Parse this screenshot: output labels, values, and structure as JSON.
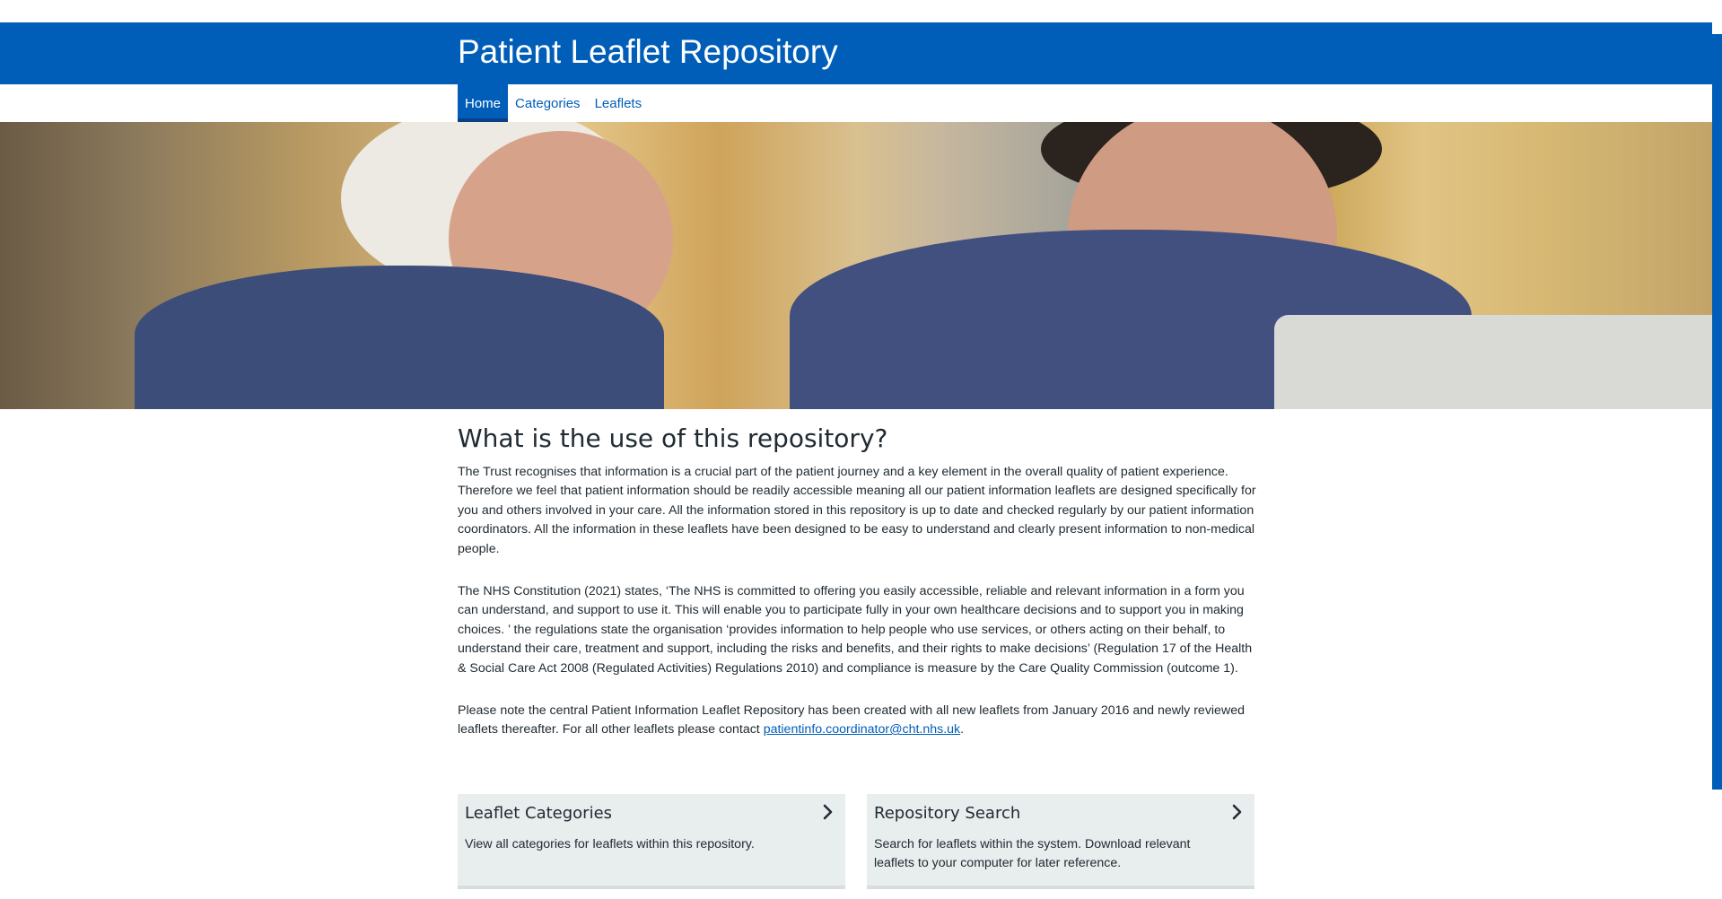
{
  "header": {
    "title": "Patient Leaflet Repository"
  },
  "nav": {
    "items": [
      {
        "label": "Home",
        "active": true
      },
      {
        "label": "Categories",
        "active": false
      },
      {
        "label": "Leaflets",
        "active": false
      }
    ]
  },
  "main": {
    "heading": "What is the use of this repository?",
    "paragraph_1": "The Trust recognises that information is a crucial part of the patient journey and a key element in the overall quality of patient experience. Therefore we feel that patient information should be readily accessible meaning all our patient information leaflets are designed specifically for you and others involved in your care. All the information stored in this repository is up to date and checked regularly by our patient information coordinators. All the information in these leaflets have been designed to be easy to understand and clearly present information to non-medical people.",
    "paragraph_2": "The NHS Constitution (2021) states, ‘The NHS is committed to offering you easily accessible, reliable and relevant information in a form you can understand, and support to use it. This will enable you to participate fully in your own healthcare decisions and to support you in making choices. ’ the regulations state the organisation ‘provides information to help people who use services, or others acting on their behalf, to understand their care, treatment and support, including the risks and benefits, and their rights to make decisions’ (Regulation 17 of the Health & Social Care Act 2008 (Regulated Activities) Regulations 2010) and compliance is measure by the Care Quality Commission (outcome 1).",
    "paragraph_3_prefix": "Please note the central Patient Information Leaflet Repository has been created with all new leaflets from January 2016 and newly reviewed leaflets thereafter. For all other leaflets please contact ",
    "contact_email": "patientinfo.coordinator@cht.nhs.uk",
    "paragraph_3_suffix": "."
  },
  "cards": [
    {
      "title": "Leaflet Categories",
      "description": "View all categories for leaflets within this repository.",
      "icon": "chevron-right-icon"
    },
    {
      "title": "Repository Search",
      "description": "Search for leaflets within the system. Download relevant leaflets to your computer for later reference.",
      "icon": "chevron-right-icon"
    }
  ],
  "colors": {
    "brand_blue": "#005eb8",
    "card_bg": "#e8edee",
    "text": "#212b32"
  }
}
